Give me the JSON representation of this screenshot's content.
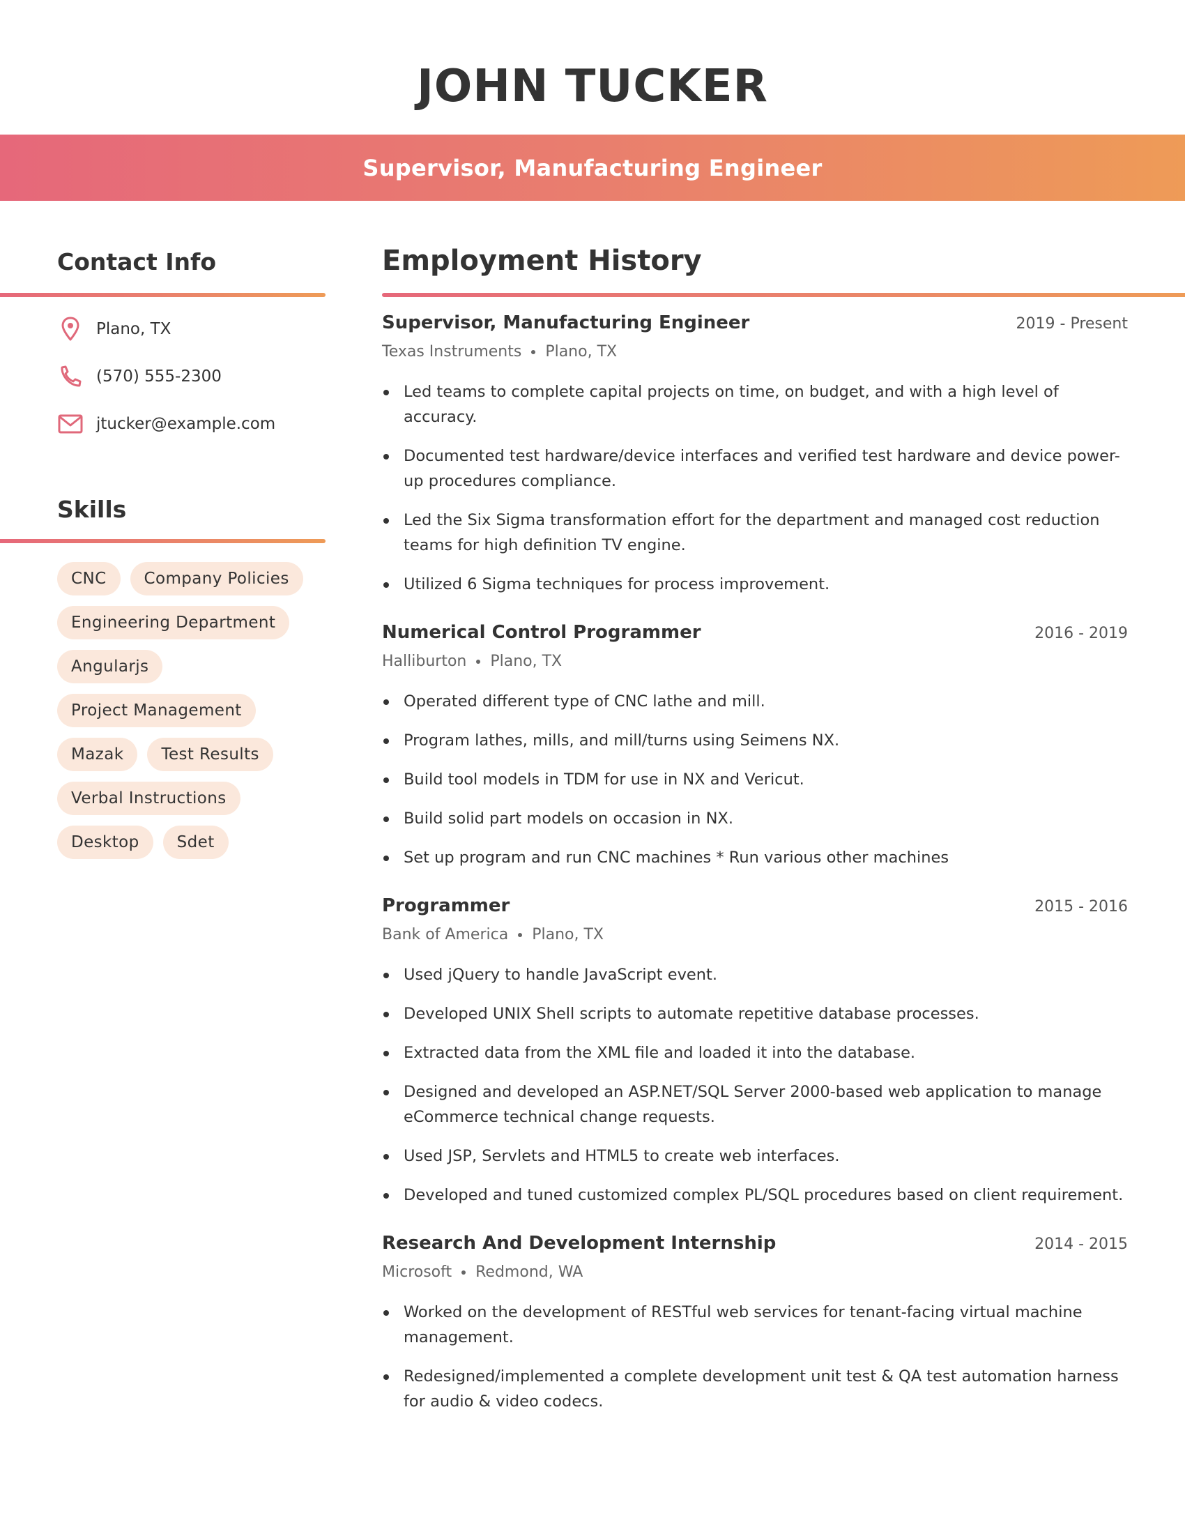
{
  "header": {
    "name": "JOHN TUCKER",
    "title": "Supervisor, Manufacturing Engineer"
  },
  "colors": {
    "accent_start": "#e6687a",
    "accent_end": "#ee9b57",
    "pill_bg": "#fbe8dc",
    "text": "#333333"
  },
  "contact": {
    "heading": "Contact Info",
    "items": [
      {
        "icon": "map-pin-icon",
        "text": "Plano, TX"
      },
      {
        "icon": "phone-icon",
        "text": "(570) 555-2300"
      },
      {
        "icon": "mail-icon",
        "text": "jtucker@example.com"
      }
    ]
  },
  "skills": {
    "heading": "Skills",
    "items": [
      "CNC",
      "Company Policies",
      "Engineering Department",
      "Angularjs",
      "Project Management",
      "Mazak",
      "Test Results",
      "Verbal Instructions",
      "Desktop",
      "Sdet"
    ]
  },
  "employment": {
    "heading": "Employment History",
    "jobs": [
      {
        "title": "Supervisor, Manufacturing Engineer",
        "dates": "2019 - Present",
        "company": "Texas Instruments",
        "location": "Plano, TX",
        "bullets": [
          "Led teams to complete capital projects on time, on budget, and with a high level of accuracy.",
          "Documented test hardware/device interfaces and verified test hardware and device power-up procedures compliance.",
          "Led the Six Sigma transformation effort for the department and managed cost reduction teams for high definition TV engine.",
          "Utilized 6 Sigma techniques for process improvement."
        ]
      },
      {
        "title": "Numerical Control Programmer",
        "dates": "2016 - 2019",
        "company": "Halliburton",
        "location": "Plano, TX",
        "bullets": [
          "Operated different type of CNC lathe and mill.",
          "Program lathes, mills, and mill/turns using Seimens NX.",
          "Build tool models in TDM for use in NX and Vericut.",
          "Build solid part models on occasion in NX.",
          "Set up program and run CNC machines * Run various other machines"
        ]
      },
      {
        "title": "Programmer",
        "dates": "2015 - 2016",
        "company": "Bank of America",
        "location": "Plano, TX",
        "bullets": [
          "Used jQuery to handle JavaScript event.",
          "Developed UNIX Shell scripts to automate repetitive database processes.",
          "Extracted data from the XML file and loaded it into the database.",
          "Designed and developed an ASP.NET/SQL Server 2000-based web application to manage eCommerce technical change requests.",
          "Used JSP, Servlets and HTML5 to create web interfaces.",
          "Developed and tuned customized complex PL/SQL procedures based on client requirement."
        ]
      },
      {
        "title": "Research And Development Internship",
        "dates": "2014 - 2015",
        "company": "Microsoft",
        "location": "Redmond, WA",
        "bullets": [
          "Worked on the development of RESTful web services for tenant-facing virtual machine management.",
          "Redesigned/implemented a complete development unit test & QA test automation harness for audio & video codecs."
        ]
      }
    ]
  }
}
